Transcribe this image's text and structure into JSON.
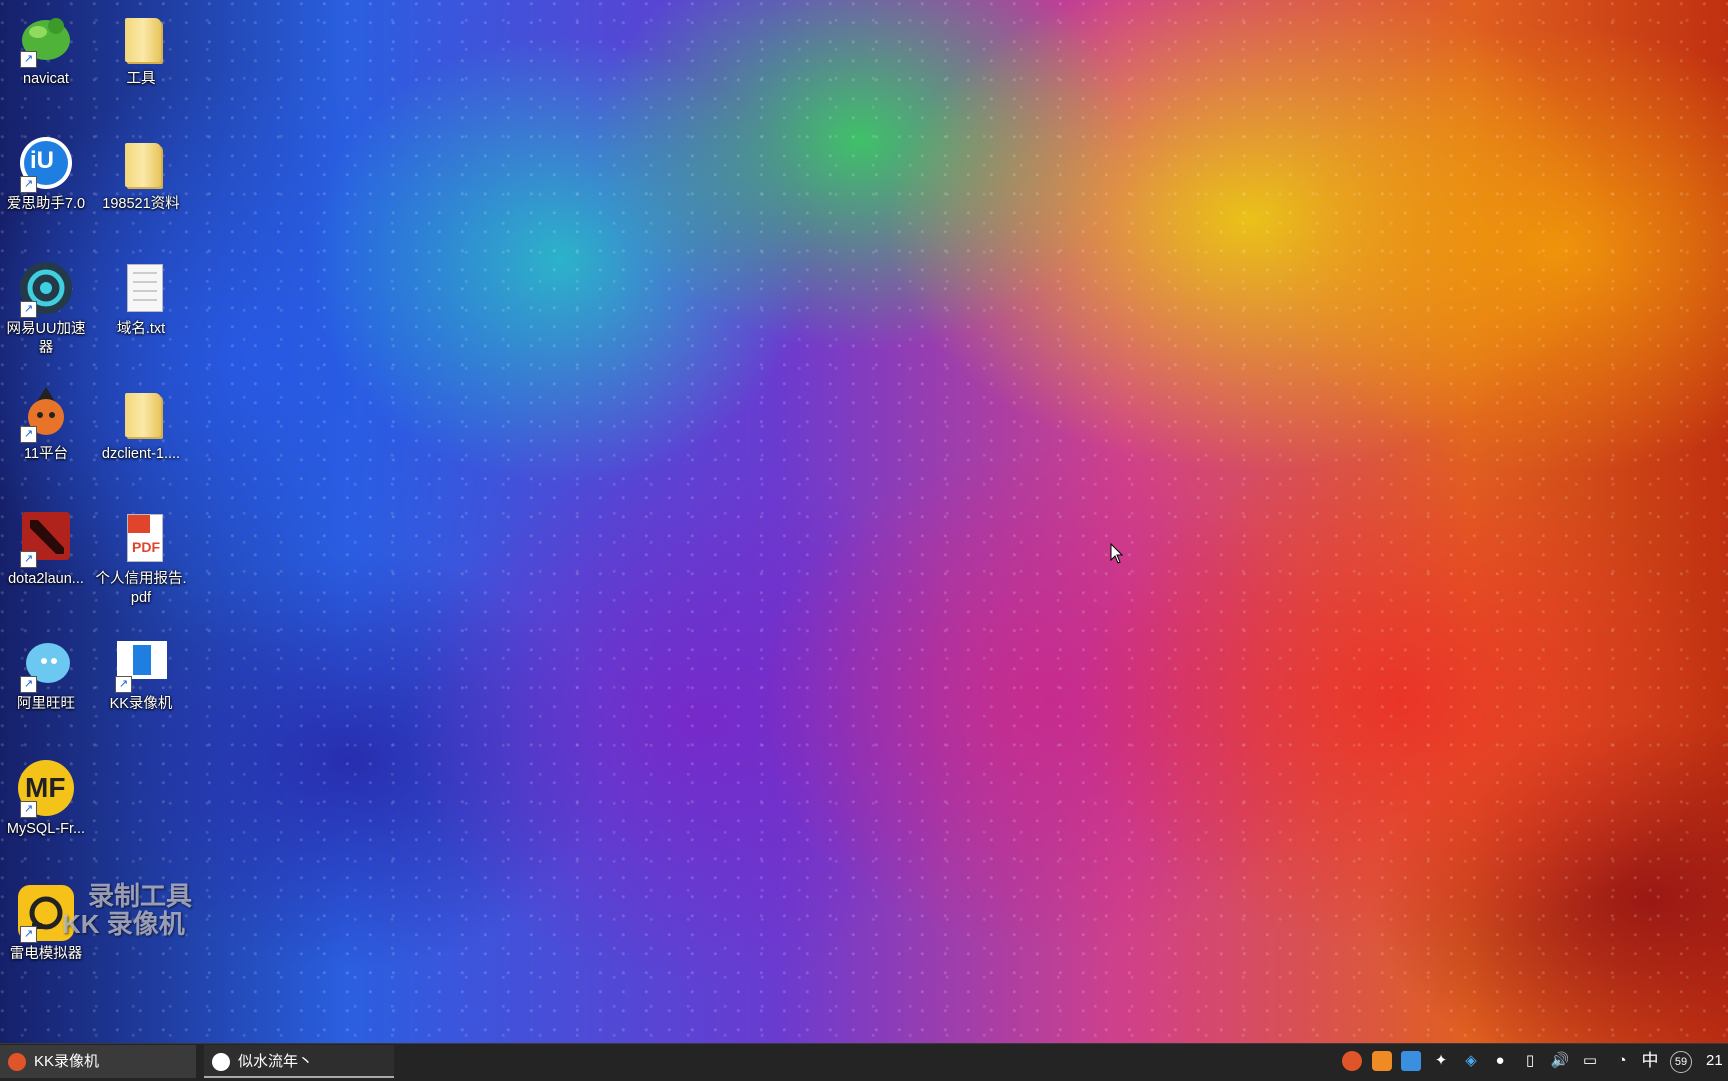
{
  "desktop": {
    "icons": [
      {
        "label": "navicat",
        "icon": "navicat-icon"
      },
      {
        "label": "工具",
        "icon": "folder-icon"
      },
      {
        "label": "爱思助手7.0",
        "icon": "aisi-icon"
      },
      {
        "label": "198521资料",
        "icon": "folder-icon"
      },
      {
        "label": "网易UU加速器",
        "icon": "uu-accelerator-icon"
      },
      {
        "label": "域名.txt",
        "icon": "text-file-icon"
      },
      {
        "label": "11平台",
        "icon": "11-platform-icon"
      },
      {
        "label": "dzclient-1....",
        "icon": "folder-icon"
      },
      {
        "label": "dota2laun...",
        "icon": "dota2-icon"
      },
      {
        "label": "个人信用报告.pdf",
        "icon": "pdf-icon"
      },
      {
        "label": "阿里旺旺",
        "icon": "aliwangwang-icon"
      },
      {
        "label": "KK录像机",
        "icon": "kk-recorder-icon"
      },
      {
        "label": "MySQL-Fr...",
        "icon": "mysql-front-icon"
      },
      {
        "label": "雷电模拟器",
        "icon": "ldplayer-icon"
      }
    ],
    "watermark": {
      "line1": "录制工具",
      "line2": "KK 录像机"
    },
    "pdf_badge": "PDF",
    "mysql_badge": "MF",
    "aisi_badge": "iU"
  },
  "taskbar": {
    "tasks": [
      {
        "label": "KK录像机",
        "icon": "kk-recorder-icon"
      },
      {
        "label": "似水流年丶",
        "icon": "qq-icon"
      }
    ],
    "tray": {
      "ime": "中",
      "badge": "59",
      "clock": "21"
    }
  },
  "colors": {
    "taskbar": "#242424",
    "label_text": "#ffffff"
  }
}
